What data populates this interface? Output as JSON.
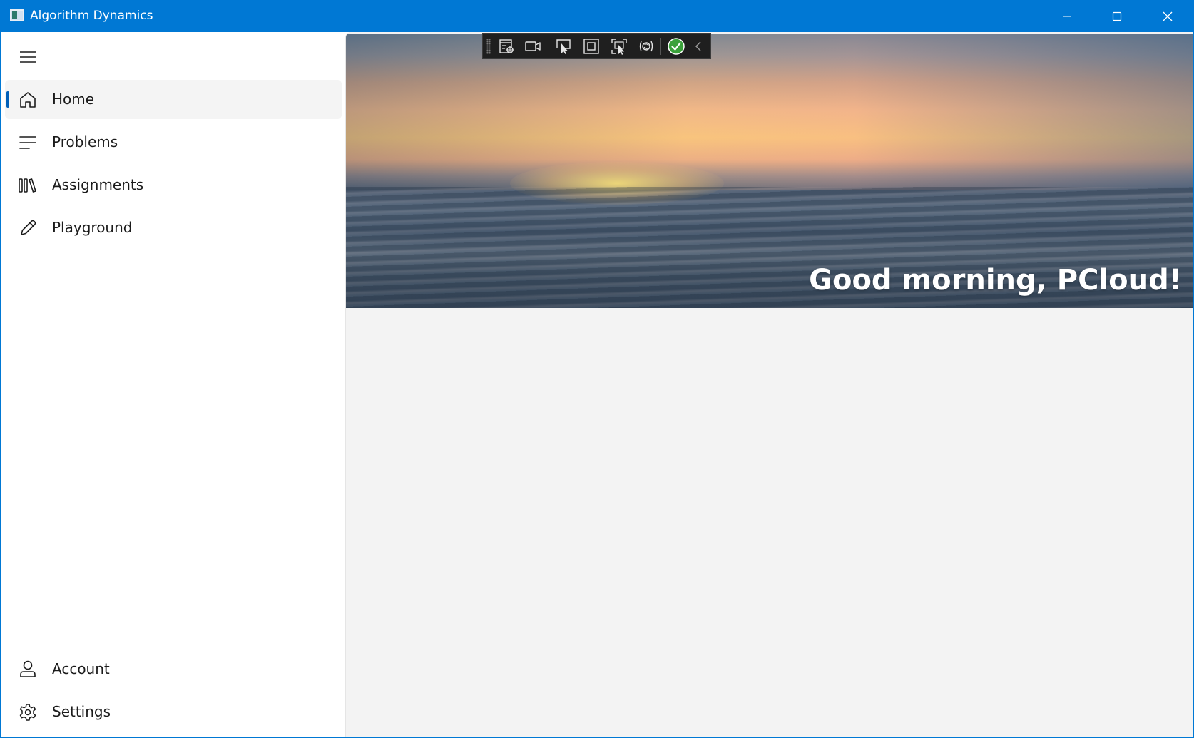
{
  "window": {
    "title": "Algorithm Dynamics",
    "accent_color": "#0078d4",
    "controls": {
      "minimize_icon": "minimize-icon",
      "maximize_icon": "maximize-icon",
      "close_icon": "close-icon"
    }
  },
  "nav": {
    "menu_icon": "hamburger-icon",
    "selected_indicator_color": "#005fb8",
    "items": [
      {
        "label": "Home",
        "icon": "home-icon",
        "selected": true
      },
      {
        "label": "Problems",
        "icon": "list-icon",
        "selected": false
      },
      {
        "label": "Assignments",
        "icon": "library-icon",
        "selected": false
      },
      {
        "label": "Playground",
        "icon": "pencil-icon",
        "selected": false
      }
    ],
    "footer_items": [
      {
        "label": "Account",
        "icon": "person-icon"
      },
      {
        "label": "Settings",
        "icon": "gear-icon"
      }
    ]
  },
  "hero": {
    "greeting": "Good morning, PCloud!"
  },
  "debug_toolbar": {
    "buttons": [
      "live-visual-tree-icon",
      "record-video-icon",
      "select-element-icon",
      "display-layout-adorners-icon",
      "track-focus-icon",
      "hot-reload-icon",
      "binding-failures-ok-icon",
      "collapse-toolbar-icon"
    ]
  }
}
